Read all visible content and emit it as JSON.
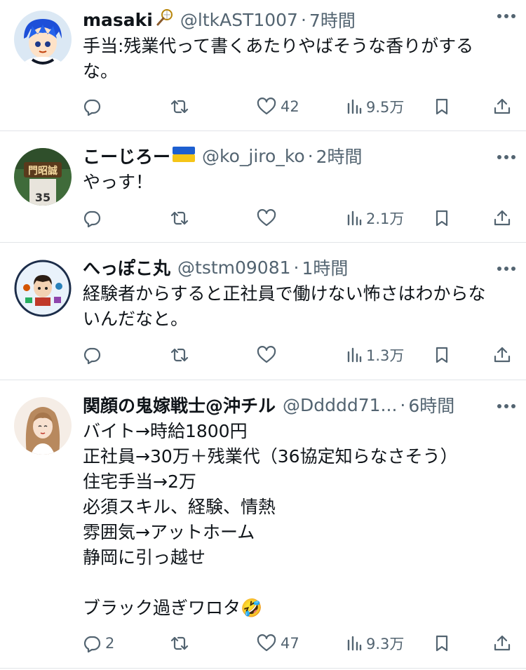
{
  "tweets": [
    {
      "name": "masaki",
      "name_emoji": "badminton-racket",
      "handle": "@ltkAST1007",
      "time": "7時間",
      "body": "手当:残業代って書くあたりやばそうな香りがする\nな。",
      "replies": "",
      "retweets": "",
      "likes": "42",
      "views": "9.5万"
    },
    {
      "name": "こーじろー",
      "name_emoji": "ukraine-flag",
      "handle": "@ko_jiro_ko",
      "time": "2時間",
      "body": "やっす！",
      "replies": "",
      "retweets": "",
      "likes": "",
      "views": "2.1万"
    },
    {
      "name": "へっぽこ丸",
      "name_emoji": "",
      "handle": "@tstm09081",
      "time": "1時間",
      "body": "経験者からすると正社員で働けない怖さはわからな\nいんだなと。",
      "replies": "",
      "retweets": "",
      "likes": "",
      "views": "1.3万"
    },
    {
      "name": "関顔の鬼嫁戦士@沖チル",
      "name_emoji": "",
      "handle": "@Ddddd71...",
      "time": "6時間",
      "body": "バイト→時給1800円\n正社員→30万＋残業代（36協定知らなさそう）\n住宅手当→2万\n必須スキル、経験、情熱\n雰囲気→アットホーム\n静岡に引っ越せ\n\nブラック過ぎワロタ🤣",
      "replies": "2",
      "retweets": "",
      "likes": "47",
      "views": "9.3万"
    }
  ],
  "separator": "·",
  "colors": {
    "text": "#0f1419",
    "secondary": "#536471",
    "border": "#e1e4e8"
  }
}
